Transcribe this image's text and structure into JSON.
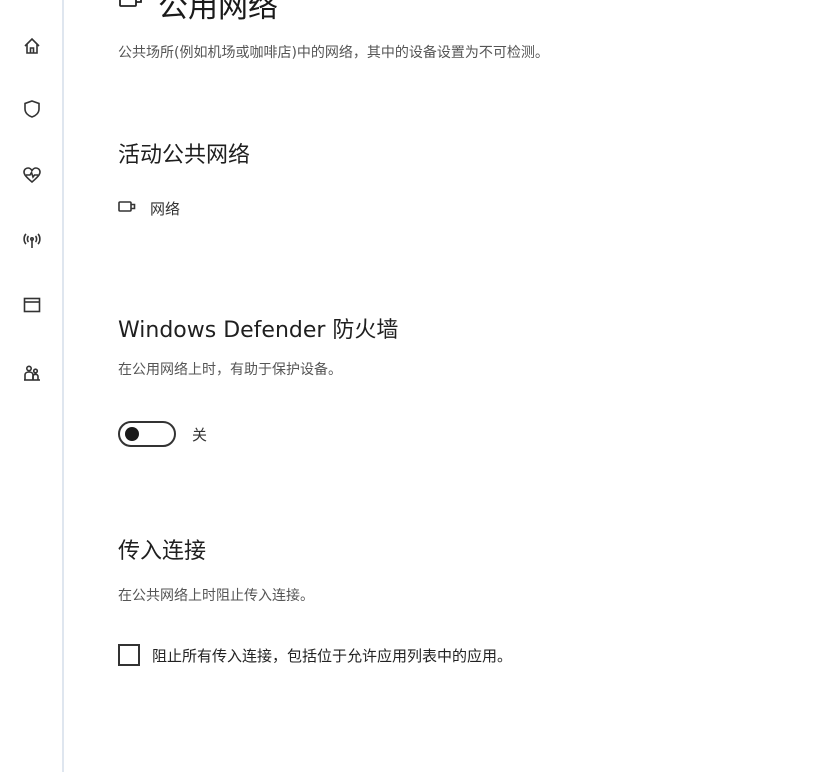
{
  "header": {
    "title": "公用网络",
    "title_icon": "public-network-icon",
    "description": "公共场所(例如机场或咖啡店)中的网络，其中的设备设置为不可检测。"
  },
  "sidebar": {
    "items": [
      {
        "icon": "home-icon"
      },
      {
        "icon": "shield-icon"
      },
      {
        "icon": "heart-pulse-icon"
      },
      {
        "icon": "wifi-signal-icon"
      },
      {
        "icon": "app-browser-icon"
      },
      {
        "icon": "family-icon"
      }
    ]
  },
  "active_network": {
    "title": "活动公共网络",
    "network_icon": "network-icon",
    "network_name": "网络"
  },
  "firewall": {
    "title": "Windows Defender 防火墙",
    "description": "在公用网络上时，有助于保护设备。",
    "toggle_state": "关",
    "toggle_on": false
  },
  "incoming": {
    "title": "传入连接",
    "description": "在公共网络上时阻止传入连接。",
    "checkbox_label": "阻止所有传入连接，包括位于允许应用列表中的应用。",
    "checked": false
  }
}
